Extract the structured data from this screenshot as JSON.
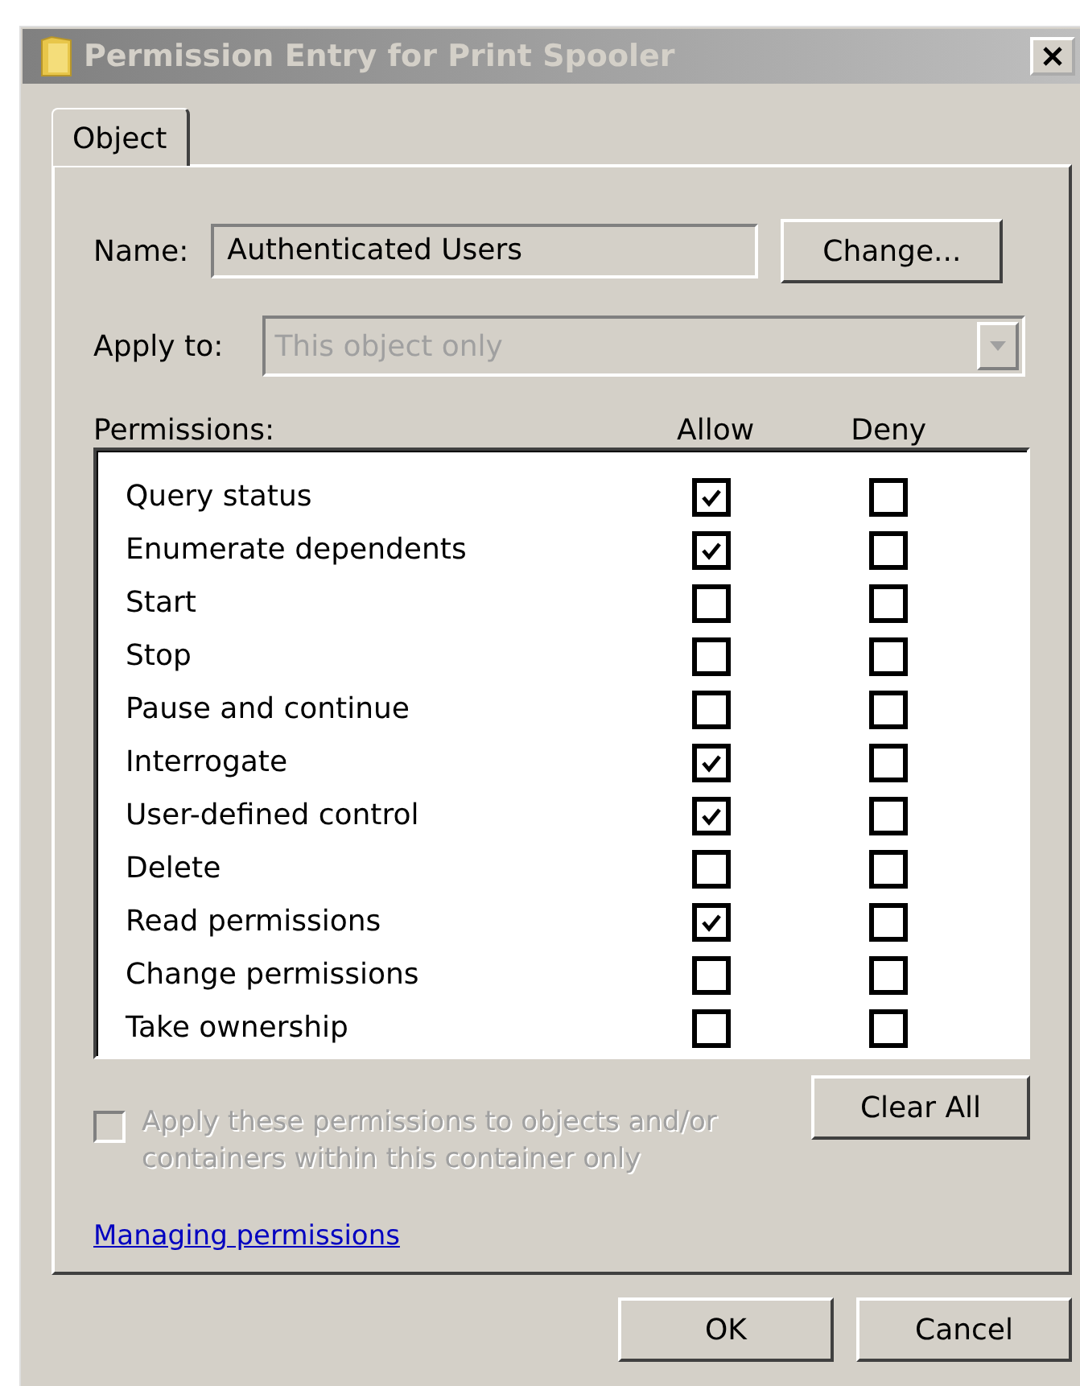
{
  "window": {
    "title": "Permission Entry for Print Spooler"
  },
  "tabs": [
    {
      "label": "Object",
      "selected": true
    }
  ],
  "name_field": {
    "label": "Name:",
    "value": "Authenticated Users",
    "button": "Change..."
  },
  "apply_to": {
    "label": "Apply to:",
    "value": "This object only",
    "disabled": true
  },
  "permissions": {
    "label": "Permissions:",
    "allow_header": "Allow",
    "deny_header": "Deny",
    "rows": [
      {
        "name": "Query status",
        "allow": true,
        "deny": false
      },
      {
        "name": "Enumerate dependents",
        "allow": true,
        "deny": false
      },
      {
        "name": "Start",
        "allow": false,
        "deny": false
      },
      {
        "name": "Stop",
        "allow": false,
        "deny": false
      },
      {
        "name": "Pause and continue",
        "allow": false,
        "deny": false
      },
      {
        "name": "Interrogate",
        "allow": true,
        "deny": false
      },
      {
        "name": "User-defined control",
        "allow": true,
        "deny": false
      },
      {
        "name": "Delete",
        "allow": false,
        "deny": false
      },
      {
        "name": "Read permissions",
        "allow": true,
        "deny": false
      },
      {
        "name": "Change permissions",
        "allow": false,
        "deny": false
      },
      {
        "name": "Take ownership",
        "allow": false,
        "deny": false
      }
    ]
  },
  "apply_inherit": {
    "label": "Apply these permissions to objects and/or containers within this container only",
    "checked": false,
    "disabled": true
  },
  "clear_button": "Clear All",
  "help_link": "Managing permissions",
  "buttons": [
    "OK",
    "Cancel"
  ]
}
